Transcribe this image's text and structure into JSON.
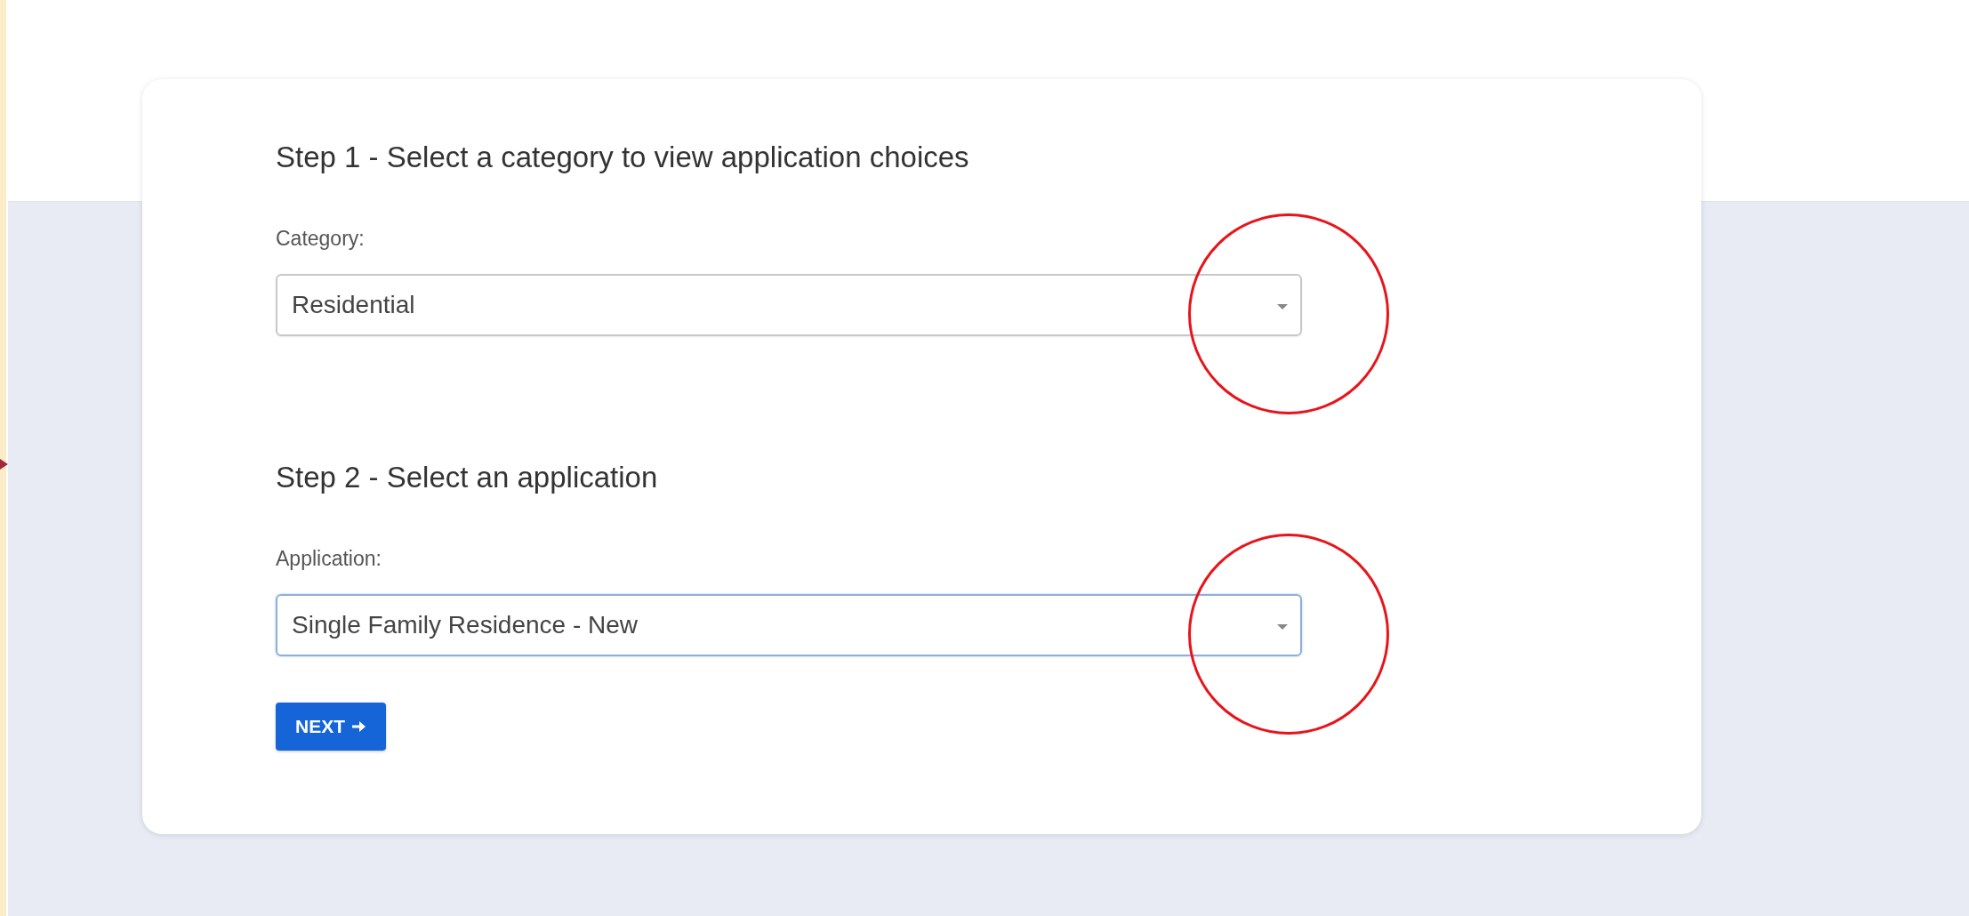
{
  "steps": [
    {
      "heading": "Step 1 - Select a category to view application choices",
      "label": "Category:",
      "value": "Residential",
      "focused": false,
      "circled": true
    },
    {
      "heading": "Step 2 - Select an application",
      "label": "Application:",
      "value": "Single Family Residence - New",
      "focused": true,
      "circled": true
    }
  ],
  "next_button": {
    "label": "NEXT"
  }
}
